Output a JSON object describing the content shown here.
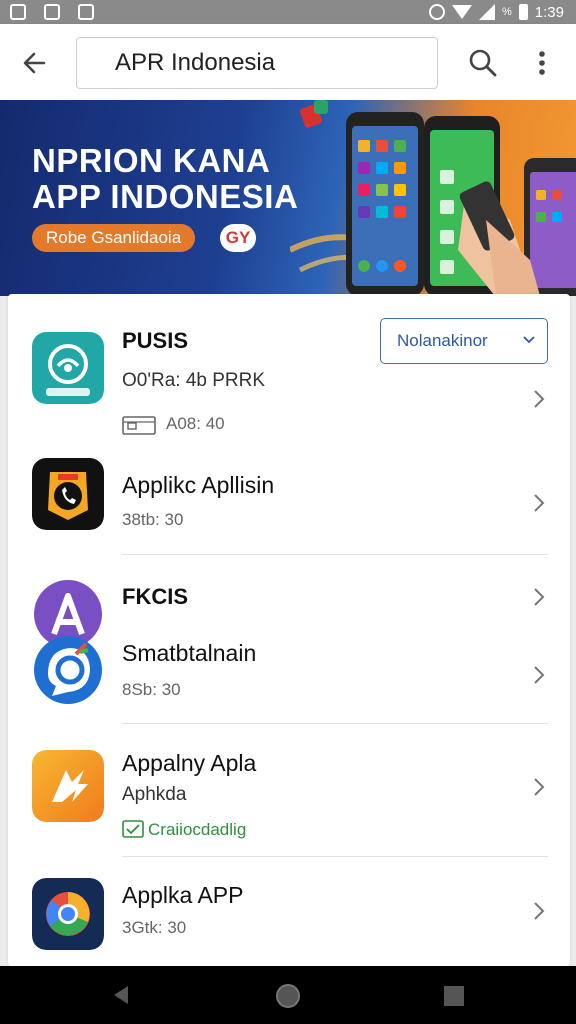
{
  "status_bar": {
    "time": "1:39",
    "battery_text": "%"
  },
  "search": {
    "query": "APR Indonesia"
  },
  "banner": {
    "title_line1": "NPRION KANA",
    "title_line2": "APP INDONESIA",
    "pill_text": "Robe Gsanlidaoia",
    "badge_text": "GY"
  },
  "apps": [
    {
      "name": "PUSIS",
      "subtitle": "O0'Ra: 4b PRRK",
      "meta": "A08: 40",
      "button_label": "Nolanakinor"
    },
    {
      "name": "Applikc Apllisin",
      "meta": "38tb: 30"
    },
    {
      "name": "FKCIS"
    },
    {
      "name": "Smatbtalnain",
      "meta": "8Sb: 30"
    },
    {
      "name": "Appalny Apla",
      "subtitle": "Aphkda",
      "meta": "Craiiocdadlig"
    },
    {
      "name": "Applka APP",
      "meta": "3Gtk: 30"
    }
  ],
  "colors": {
    "accent_blue": "#3f6fbf",
    "banner_orange": "#e37a2b",
    "green_meta": "#2f8f3d"
  }
}
